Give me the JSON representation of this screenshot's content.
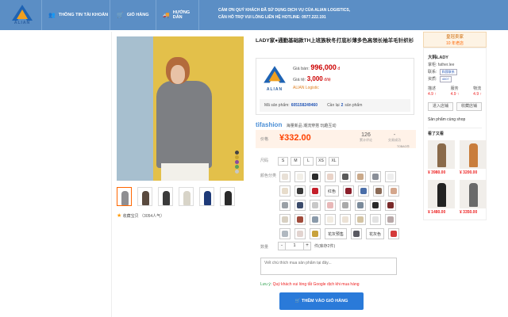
{
  "header": {
    "logo_text": "ALIAN",
    "nav": [
      {
        "label": "THÔNG TIN TÀI KHOẢN",
        "icon": "user-group-icon"
      },
      {
        "label": "GIỎ HÀNG",
        "icon": "cart-icon"
      },
      {
        "label": "HƯỚNG DẪN",
        "icon": "truck-icon"
      }
    ],
    "notice_line1": "CẢM ƠN QUÝ KHÁCH ĐÃ SỬ DỤNG DỊCH VỤ CỦA ALIAN LOGISTICS,",
    "notice_line2": "CẦN HỖ TRỢ VUI LÒNG LIÊN HỆ HOTLINE: 0977.222.191"
  },
  "product": {
    "title": "LADY家●通勤基础款TH上班族秋冬打底衫薄多色高领长袖羊毛针织衫",
    "thumb_colors": [
      "#8e8e92",
      "#5a4a3e",
      "#3a3a3a",
      "#d8d4c8",
      "#1e3a78",
      "#2a2a2a"
    ],
    "favorite": "收藏宝贝 （3054人气）",
    "main_swatches": [
      "#444",
      "#c9a62f",
      "#8a4aa0",
      "#5aa35a",
      "#c7c7c7"
    ]
  },
  "pricebox": {
    "logo_text": "ALIAN",
    "sell_label": "Giá bán:",
    "sell_value": "996,000",
    "sell_unit": "đ",
    "rate_label": "Giá tệ:",
    "rate_value": "3,000",
    "rate_unit": "đ/tệ",
    "brand": "ALIAN Logistic",
    "code_label": "Mã sản phẩm:",
    "code_value": "605158249460",
    "buy_label": "Cần lại",
    "buy_count": "2",
    "buy_suffix": "sản phẩm"
  },
  "tfashion": {
    "mark": "tifashion",
    "text": "海量新品 潮流穿搭 玩趣互动"
  },
  "pricebar": {
    "label": "价格",
    "price": "¥332.00",
    "reviews_count": "126",
    "reviews_label": "累计评论",
    "trades_count": "-",
    "trades_label": "交易成功",
    "link": "TOBAO币"
  },
  "attrs": {
    "size_label": "尺码",
    "sizes": [
      "S",
      "M",
      "L",
      "XS",
      "XL"
    ],
    "color_label": "颜色分类",
    "color_label_inline": "红色",
    "color_label_inline2": "花灰预售",
    "color_label_inline3": "花灰色",
    "qty_label": "数量",
    "qty_value": "1",
    "qty_unit": "件(库存2件)",
    "qty_minus": "-",
    "qty_plus": "+"
  },
  "order": {
    "note_placeholder": "Viết chú thích mua sản phẩm tại đây...",
    "tip_prefix": "Lưu ý:",
    "tip_text": "Quý khách vui lòng tắt Google dịch khi mua hàng",
    "add_to_cart": "THÊM VÀO GIỎ HÀNG"
  },
  "shop": {
    "heading": "皇冠卖家",
    "badge": "10 年老店",
    "name": "大韩LADY",
    "seller_label": "掌柜:",
    "seller": "father.lee",
    "contact_label": "联系:",
    "contact": "和我联系",
    "qual_label": "资质:",
    "qual_badge": "4007",
    "scores": [
      {
        "label": "描述",
        "value": "4.9 ↑"
      },
      {
        "label": "服务",
        "value": "4.9 ↑"
      },
      {
        "label": "物流",
        "value": "4.9 ↑"
      }
    ],
    "enter_shop": "进入店铺",
    "fav_shop": "收藏店铺",
    "same_shop": "Sản phẩm cùng shop",
    "recommend_title": "看了又看",
    "recommend": [
      {
        "price": "¥ 3980.00",
        "color": "#8a6a4a"
      },
      {
        "price": "¥ 3200.00",
        "color": "#c97d3c"
      },
      {
        "price": "¥ 1480.00",
        "color": "#222"
      },
      {
        "price": "¥ 3350.00",
        "color": "#6a6a6a"
      }
    ]
  }
}
